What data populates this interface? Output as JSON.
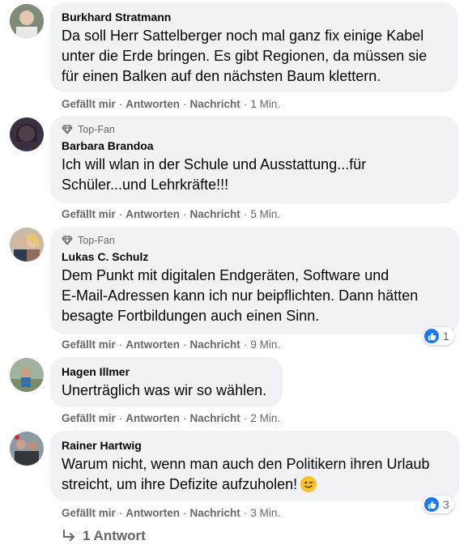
{
  "comments": [
    {
      "author": "Burkhard Stratmann",
      "lines": [
        "Da soll Herr Sattelberger noch mal ganz fix einige Kabel",
        "unter die Erde bringen. Es gibt Regionen, da müssen sie",
        "für einen Balken auf den nächsten Baum klettern."
      ],
      "actions": {
        "like": "Gefällt mir",
        "reply": "Antworten",
        "message": "Nachricht",
        "time": "1 Min."
      }
    },
    {
      "badge": "Top-Fan",
      "author": "Barbara Brandoa",
      "lines": [
        "Ich will wlan in der Schule und Ausstattung...für",
        "Schüler...und Lehrkräfte!!!"
      ],
      "actions": {
        "like": "Gefällt mir",
        "reply": "Antworten",
        "message": "Nachricht",
        "time": "5 Min."
      }
    },
    {
      "badge": "Top-Fan",
      "author": "Lukas C. Schulz",
      "lines": [
        "Dem Punkt mit digitalen Endgeräten, Software und",
        "E-Mail-Adressen kann ich nur beipflichten. Dann hätten",
        "besagte Fortbildungen auch einen Sinn."
      ],
      "reactions": "1",
      "actions": {
        "like": "Gefällt mir",
        "reply": "Antworten",
        "message": "Nachricht",
        "time": "9 Min."
      }
    },
    {
      "author": "Hagen Illmer",
      "lines": [
        "Unerträglich was wir so wählen."
      ],
      "actions": {
        "like": "Gefällt mir",
        "reply": "Antworten",
        "message": "Nachricht",
        "time": "2 Min."
      }
    },
    {
      "author": "Rainer Hartwig",
      "lines": [
        "Warum nicht, wenn man auch den Politikern ihren Urlaub",
        "streicht, um ihre Defizite aufzuholen!"
      ],
      "reactions": "3",
      "actions": {
        "like": "Gefällt mir",
        "reply": "Antworten",
        "message": "Nachricht",
        "time": "3 Min."
      }
    }
  ],
  "replies_link": "1 Antwort",
  "colors": {
    "bubble": "#f0f2f5",
    "meta": "#65676b",
    "text": "#050505",
    "like_blue": "#1877f2"
  },
  "icons": [
    "top-fan-gem-icon",
    "like-thumb-icon",
    "reply-arrow-icon",
    "wink-emoji-icon"
  ]
}
